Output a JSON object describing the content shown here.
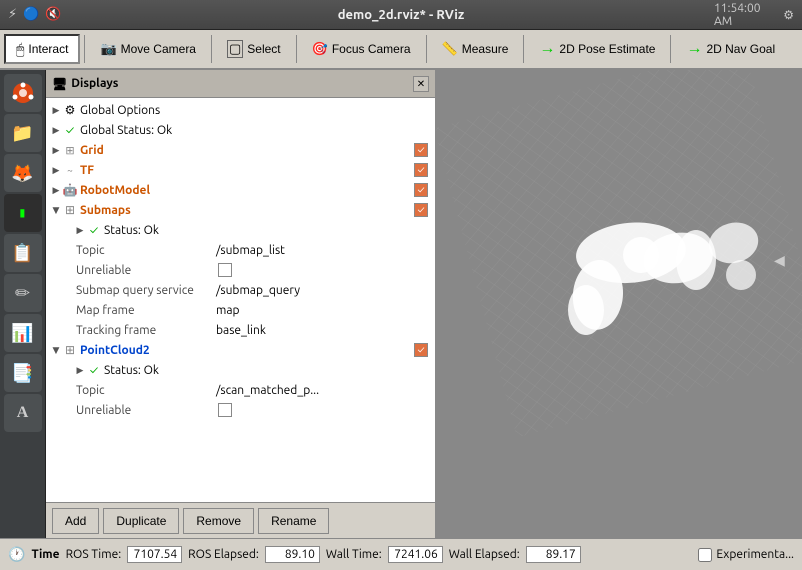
{
  "titlebar": {
    "title": "demo_2d.rviz* - RViz",
    "icons": [
      "⚡",
      "🔵",
      "🔇",
      "⚙"
    ]
  },
  "toolbar": {
    "buttons": [
      {
        "id": "interact",
        "label": "Interact",
        "icon": "🖱",
        "active": true
      },
      {
        "id": "move-camera",
        "label": "Move Camera",
        "icon": "🎥",
        "active": false
      },
      {
        "id": "select",
        "label": "Select",
        "icon": "⬜",
        "active": false
      },
      {
        "id": "focus-camera",
        "label": "Focus Camera",
        "icon": "🎯",
        "active": false
      },
      {
        "id": "measure",
        "label": "Measure",
        "icon": "📏",
        "active": false
      },
      {
        "id": "2d-pose-estimate",
        "label": "2D Pose Estimate",
        "icon": "→",
        "active": false
      },
      {
        "id": "2d-nav-goal",
        "label": "2D Nav Goal",
        "icon": "→",
        "active": false
      }
    ]
  },
  "displays": {
    "header": "Displays",
    "items": [
      {
        "id": "global-options",
        "label": "Global Options",
        "indent": 0,
        "type": "settings",
        "hasCheck": false
      },
      {
        "id": "global-status",
        "label": "Global Status: Ok",
        "indent": 0,
        "type": "status-ok",
        "hasCheck": false
      },
      {
        "id": "grid",
        "label": "Grid",
        "indent": 0,
        "type": "grid",
        "hasCheck": true,
        "checked": true,
        "color": "orange"
      },
      {
        "id": "tf",
        "label": "TF",
        "indent": 0,
        "type": "tf",
        "hasCheck": true,
        "checked": true,
        "color": "orange"
      },
      {
        "id": "robot-model",
        "label": "RobotModel",
        "indent": 0,
        "type": "robot",
        "hasCheck": true,
        "checked": true,
        "color": "orange"
      },
      {
        "id": "submaps",
        "label": "Submaps",
        "indent": 0,
        "type": "submaps",
        "hasCheck": true,
        "checked": true,
        "color": "orange",
        "expanded": true
      },
      {
        "id": "submaps-status",
        "label": "Status: Ok",
        "indent": 1,
        "type": "status-ok",
        "hasCheck": false
      },
      {
        "id": "submaps-topic-label",
        "label": "Topic",
        "indent": 1,
        "type": "property",
        "propValue": "/submap_list"
      },
      {
        "id": "submaps-unreliable-label",
        "label": "Unreliable",
        "indent": 1,
        "type": "property-cb",
        "propValue": ""
      },
      {
        "id": "submaps-submap-query-label",
        "label": "Submap query service",
        "indent": 1,
        "type": "property",
        "propValue": "/submap_query"
      },
      {
        "id": "submaps-map-frame-label",
        "label": "Map frame",
        "indent": 1,
        "type": "property",
        "propValue": "map"
      },
      {
        "id": "submaps-tracking-label",
        "label": "Tracking frame",
        "indent": 1,
        "type": "property",
        "propValue": "base_link"
      },
      {
        "id": "pointcloud2",
        "label": "PointCloud2",
        "indent": 0,
        "type": "pointcloud",
        "hasCheck": true,
        "checked": true,
        "color": "orange",
        "expanded": true
      },
      {
        "id": "pointcloud2-status",
        "label": "Status: Ok",
        "indent": 1,
        "type": "status-ok",
        "hasCheck": false
      },
      {
        "id": "pointcloud2-topic-label",
        "label": "Topic",
        "indent": 1,
        "type": "property",
        "propValue": "/scan_matched_p..."
      },
      {
        "id": "pointcloud2-unreliable-label",
        "label": "Unreliable",
        "indent": 1,
        "type": "property-cb",
        "propValue": ""
      }
    ],
    "footer_buttons": [
      "Add",
      "Duplicate",
      "Remove",
      "Rename"
    ]
  },
  "statusbar": {
    "ros_time_label": "ROS Time:",
    "ros_time_value": "7107.54",
    "ros_elapsed_label": "ROS Elapsed:",
    "ros_elapsed_value": "89.10",
    "wall_time_label": "Wall Time:",
    "wall_time_value": "7241.06",
    "wall_elapsed_label": "Wall Elapsed:",
    "wall_elapsed_value": "89.17",
    "experimental_label": "Experimenta...",
    "time_header": "Time"
  },
  "sidebar_icons": [
    "🐧",
    "📁",
    "🦊",
    "💻",
    "📋",
    "✏",
    "📊",
    "📑",
    "A"
  ]
}
